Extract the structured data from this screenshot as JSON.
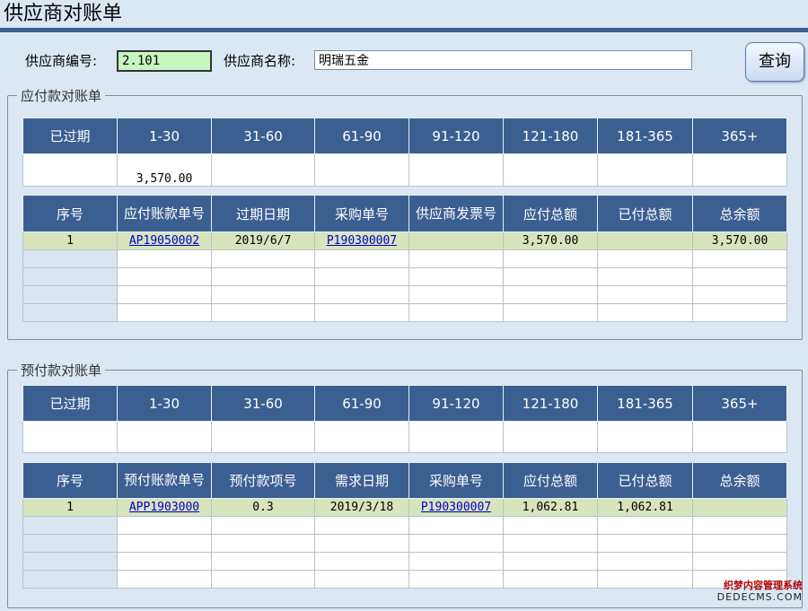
{
  "window": {
    "title": "供应商对账单"
  },
  "supplier": {
    "code_label": "供应商编号:",
    "code_value": "2.101",
    "name_label": "供应商名称:",
    "name_value": "明瑞五金"
  },
  "query_label": "查询",
  "payable": {
    "legend": "应付款对账单",
    "aging_headers": [
      "已过期",
      "1-30",
      "31-60",
      "61-90",
      "91-120",
      "121-180",
      "181-365",
      "365+"
    ],
    "aging_values": [
      "",
      "3,570.00",
      "",
      "",
      "",
      "",
      "",
      ""
    ],
    "detail_headers": [
      "序号",
      "应付账款单号",
      "过期日期",
      "采购单号",
      "供应商发票号",
      "应付总额",
      "已付总额",
      "总余额"
    ],
    "rows": [
      [
        "1",
        "AP19050002",
        "2019/6/7",
        "P190300007",
        "",
        "3,570.00",
        "",
        "3,570.00"
      ]
    ]
  },
  "prepaid": {
    "legend": "预付款对账单",
    "aging_headers": [
      "已过期",
      "1-30",
      "31-60",
      "61-90",
      "91-120",
      "121-180",
      "181-365",
      "365+"
    ],
    "aging_values": [
      "",
      "",
      "",
      "",
      "",
      "",
      "",
      ""
    ],
    "detail_headers": [
      "序号",
      "预付账款单号",
      "预付款项号",
      "需求日期",
      "采购单号",
      "应付总额",
      "已付总额",
      "总余额"
    ],
    "rows": [
      [
        "1",
        "APP1903000",
        "0.3",
        "2019/3/18",
        "P190300007",
        "1,062.81",
        "1,062.81",
        ""
      ]
    ]
  },
  "watermark": {
    "line1": "织梦内容管理系统",
    "line2": "DEDECMS.COM"
  },
  "colors": {
    "header_bg": "#3c5f92",
    "highlight_row": "#d8e4bc",
    "input_active": "#c7f7c0"
  }
}
